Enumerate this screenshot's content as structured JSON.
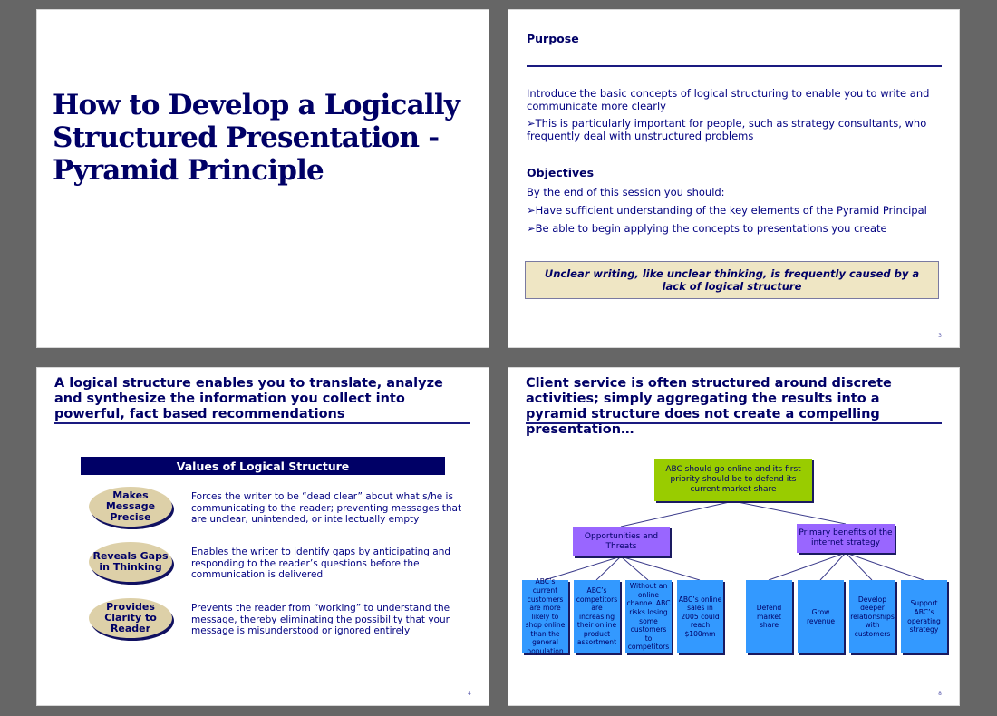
{
  "slide1": {
    "title": "How to Develop a Logically Structured Presentation - Pyramid Principle"
  },
  "slide2": {
    "purpose_heading": "Purpose",
    "purpose_text": "Introduce the basic concepts of logical structuring to enable you to write and communicate more clearly",
    "purpose_bullet": "➢This is particularly important for people, such as strategy consultants, who frequently deal with unstructured problems",
    "objectives_heading": "Objectives",
    "objectives_intro": "By the end of this session you should:",
    "objectives_bullets": [
      "➢Have sufficient understanding of the key elements of the Pyramid Principal",
      "➢Be able to begin applying the concepts to presentations you create"
    ],
    "quote": "Unclear writing, like unclear thinking, is frequently caused by a lack of logical structure",
    "page_number": "3"
  },
  "slide3": {
    "headline": "A logical structure enables you to translate, analyze and synthesize the information you collect into powerful, fact based recommendations",
    "table_header": "Values of Logical Structure",
    "values": [
      {
        "label": "Makes Message Precise",
        "text": "Forces the writer to be “dead clear” about what s/he is communicating to the reader; preventing messages that are unclear, unintended, or intellectually empty"
      },
      {
        "label": "Reveals Gaps in Thinking",
        "text": "Enables the writer to identify gaps by anticipating and responding to the reader’s questions before the communication is delivered"
      },
      {
        "label": "Provides Clarity to Reader",
        "text": "Prevents the reader from “working” to understand the message, thereby eliminating the possibility that your message is misunderstood or ignored entirely"
      }
    ],
    "page_number": "4"
  },
  "slide4": {
    "headline": "Client service is often structured around discrete activities; simply aggregating the results into a pyramid structure does not create a compelling presentation…",
    "top_box": "ABC should go online and its first priority should be to defend its current market share",
    "groups": [
      {
        "label": "Opportunities and Threats",
        "children": [
          "ABC’s current customers are more likely to shop online than the general population",
          "ABC’s competitors are increasing their online product assortment",
          "Without an online channel ABC risks losing some customers to competitors",
          "ABC’s online sales in 2005 could reach $100mm"
        ]
      },
      {
        "label": "Primary benefits of the internet strategy",
        "children": [
          "Defend market share",
          "Grow revenue",
          "Develop deeper relationships with customers",
          "Support ABC’s operating strategy"
        ]
      }
    ],
    "colors": {
      "top": "#99cc00",
      "mid": "#9966ff",
      "leaf": "#3399ff",
      "connector": "#3a3a8a"
    },
    "page_number": "8"
  }
}
